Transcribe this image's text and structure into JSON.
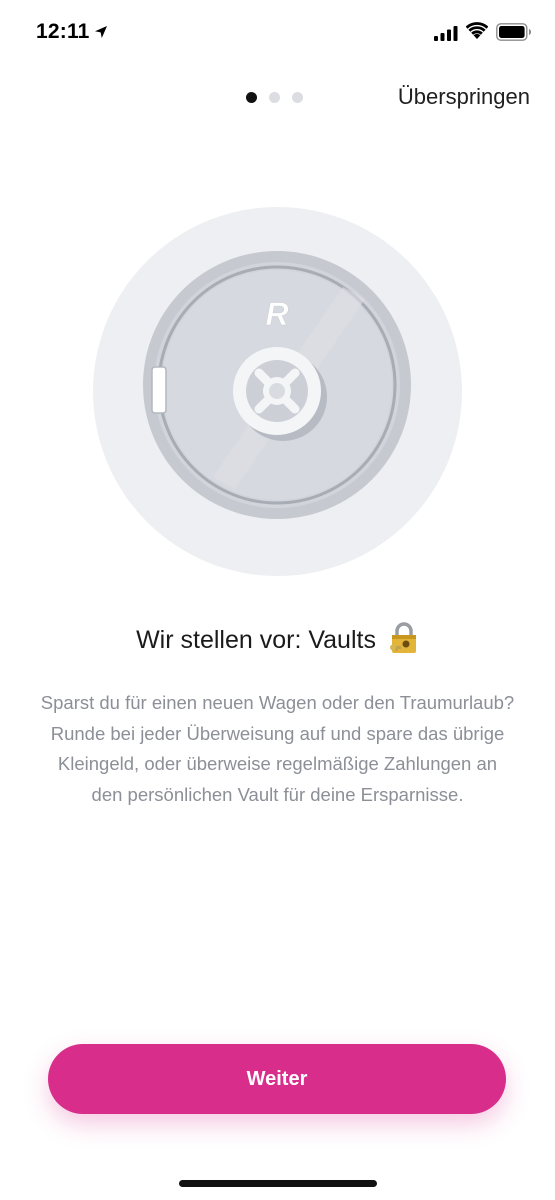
{
  "status_bar": {
    "time": "12:11",
    "icons": [
      "location-arrow-icon",
      "cellular-signal-icon",
      "wifi-icon",
      "battery-icon"
    ]
  },
  "onboarding": {
    "page_count": 3,
    "active_page": 1,
    "skip_label": "Überspringen",
    "illustration": "vault-icon",
    "vault_logo_letter": "R",
    "title": "Wir stellen vor: Vaults",
    "title_icon": "lock-with-key-emoji",
    "description": "Sparst du für einen neuen Wagen oder den Traumurlaub? Runde bei jeder Überweisung auf und spare das übrige Kleingeld, oder überweise regelmäßige Zahlungen an den persönlichen Vault für deine Ersparnisse.",
    "continue_label": "Weiter"
  },
  "colors": {
    "accent": "#d82d8b",
    "description_text": "#8c8f97",
    "dot_active": "#111111",
    "dot_inactive": "#dcdde2",
    "vault_background": "#ecedf0",
    "vault_door": "#c9ccd3"
  }
}
